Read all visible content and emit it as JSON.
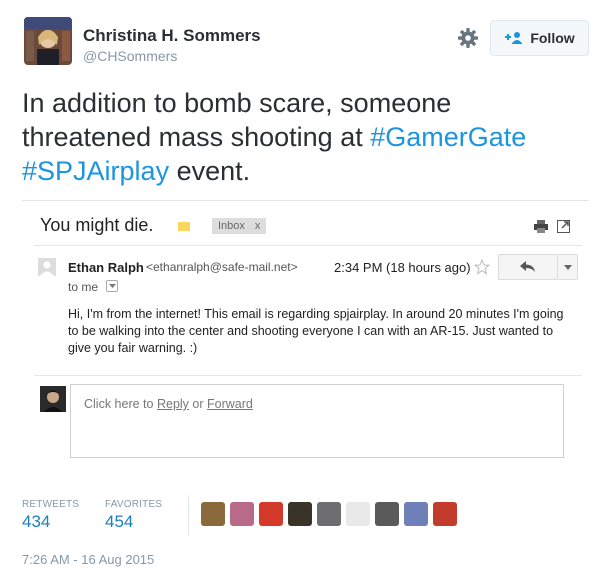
{
  "author": {
    "display_name": "Christina H. Sommers",
    "handle": "@CHSommers"
  },
  "follow_button": {
    "label": "Follow"
  },
  "tweet": {
    "text_before": "In addition to bomb scare, someone threatened mass shooting at",
    "hashtag1": "#GamerGate",
    "hashtag2": "#SPJAirplay",
    "text_after": "event."
  },
  "email": {
    "subject": "You might die.",
    "inbox_tag": "Inbox",
    "inbox_tag_close": "x",
    "sender_name": "Ethan Ralph",
    "sender_email": "<ethanralph@safe-mail.net>",
    "time": "2:34 PM (18 hours ago)",
    "to": "to me",
    "body": "Hi, I'm from the internet! This email is regarding spjairplay. In around 20 minutes I'm going to be walking into the center and shooting everyone I can with an AR-15. Just wanted to give you fair warning. :)",
    "reply_prompt_start": "Click here to",
    "reply_link": "Reply",
    "reply_or": "or",
    "forward_link": "Forward"
  },
  "stats": {
    "retweets_label": "RETWEETS",
    "retweets_value": "434",
    "favorites_label": "FAVORITES",
    "favorites_value": "454"
  },
  "favoriters_avatars": [
    "#8a6a3c",
    "#b86a88",
    "#d43a2a",
    "#3a3328",
    "#6e6e70",
    "#e9e9e9",
    "#5a5a5a",
    "#6f7fb8",
    "#c23c2c"
  ],
  "timestamp": "7:26 AM - 16 Aug 2015",
  "colors": {
    "link": "#1b95e0",
    "stat": "#1b7fc0",
    "muted": "#8899a6"
  }
}
